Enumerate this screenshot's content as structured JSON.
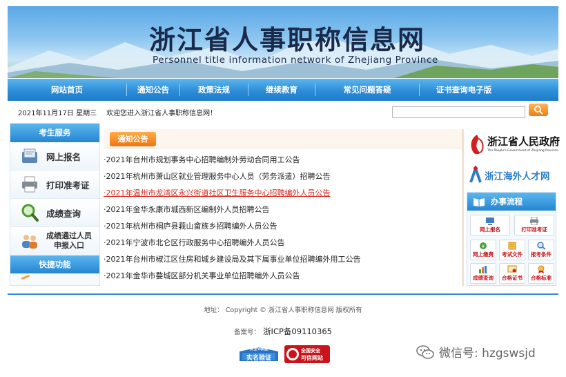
{
  "banner": {
    "title": "浙江省人事职称信息网",
    "subtitle": "Personnel title information network of Zhejiang Province"
  },
  "nav": {
    "items": [
      "网站首页",
      "通知公告",
      "政策法规",
      "继续教育",
      "常见问题答疑",
      "证书查询电子版"
    ]
  },
  "infobar": {
    "date": "2021年11月17日 星期三",
    "welcome": "欢迎您进入浙江省人事职称信息网！"
  },
  "sidebar": {
    "head": "考生服务",
    "items": [
      {
        "label": "网上报名",
        "icon": "register-icon"
      },
      {
        "label": "打印准考证",
        "icon": "printer-icon"
      },
      {
        "label": "成绩查询",
        "icon": "magnifier-icon"
      },
      {
        "label_line1": "成绩通过人员",
        "label_line2": "申报入口",
        "icon": "people-icon"
      }
    ],
    "head2": "快捷功能"
  },
  "notices": {
    "tab": "通知公告",
    "items": [
      "·2021年台州市规划事务中心招聘编制外劳动合同用工公告",
      "·2021年杭州市萧山区就业管理服务中心人员（劳务派遣）招聘公告",
      "·2021年温州市龙湾区永兴街道社区卫生服务中心招聘编外人员公告",
      "·2021年金华永康市城西新区编制外人员招聘公告",
      "·2021年杭州市桐庐县莪山畲族乡招聘编外人员公告",
      "·2021年宁波市北仑区行政服务中心招聘编外人员公告",
      "·2021年台州市椒江区住房和城乡建设局及其下属事业单位招聘编外用工公告",
      "·2021年金华市婺城区部分机关事业单位招聘编外人员公告"
    ],
    "highlight_index": 2
  },
  "right": {
    "gov_title": "浙江省人民政府",
    "gov_sub": "The People's Government of Zhejiang Province",
    "talent": "浙江海外人才网",
    "proc_head": "办事流程",
    "proc_items": [
      "网上报名",
      "打印准考证",
      "网上缴费",
      "考试文件",
      "报考条件",
      "成绩查询",
      "合格证书",
      "合格标准"
    ]
  },
  "footer": {
    "line1": "地址：  Copyright © 浙江省人事职称信息网 版权所有",
    "record_label": "备案号：",
    "icp": "浙ICP备09110365",
    "badge1_top": "安全V联盟",
    "badge1_main": "实名验证",
    "badge2_top": "全国安全",
    "badge2_main": "可信网站"
  },
  "watermark": {
    "text": "微信号: hzgswsjd"
  },
  "colors": {
    "nav_blue": "#2d8dd8",
    "accent_orange": "#ee7410",
    "link_red": "#d9261c"
  }
}
